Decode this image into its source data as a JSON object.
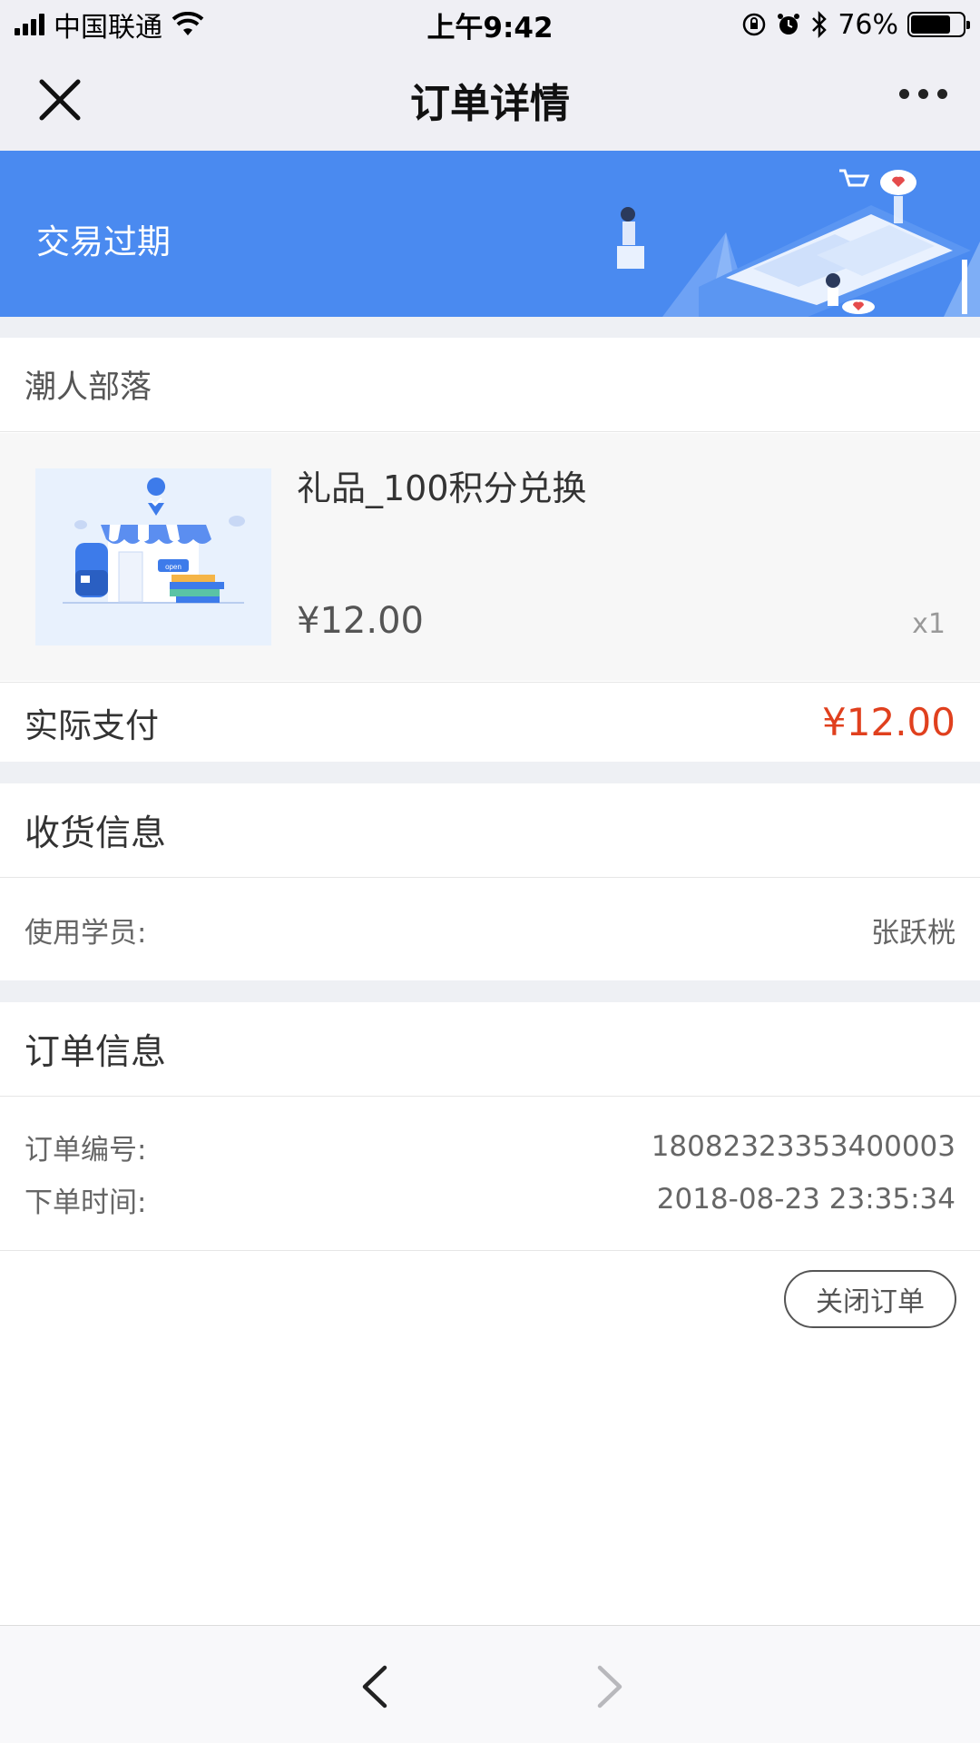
{
  "status_bar": {
    "carrier": "中国联通",
    "time": "上午9:42",
    "battery": "76%",
    "battery_level": 0.76
  },
  "nav": {
    "title": "订单详情"
  },
  "banner": {
    "status_text": "交易过期",
    "color": "#4a8af0"
  },
  "shop": {
    "name": "潮人部落"
  },
  "product": {
    "name": "礼品_100积分兑换",
    "price": "¥12.00",
    "quantity": "x1",
    "thumb_label": "open"
  },
  "payment": {
    "label": "实际支付",
    "amount": "¥12.00",
    "amount_color": "#e0401e"
  },
  "shipping": {
    "title": "收货信息",
    "student_label": "使用学员:",
    "student_value": "张跃桄"
  },
  "order_info": {
    "title": "订单信息",
    "number_label": "订单编号:",
    "number_value": "18082323353400003",
    "time_label": "下单时间:",
    "time_value": "2018-08-23 23:35:34"
  },
  "actions": {
    "close_order": "关闭订单"
  }
}
